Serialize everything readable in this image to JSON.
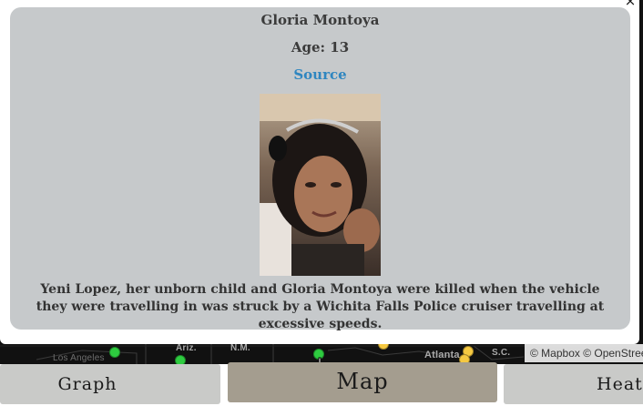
{
  "popup": {
    "name": "Gloria Montoya",
    "age": "Age: 13",
    "source_link": "Source",
    "description": "Yeni Lopez, her unborn child and Gloria Montoya were killed when the vehicle they were travelling in was struck by a Wichita Falls Police cruiser travelling at excessive speeds.",
    "close_symbol": "×",
    "photo_icon": "portrait-photo"
  },
  "map": {
    "labels": {
      "los_angeles": "Los Angeles",
      "ariz": "Ariz.",
      "nm": "N.M.",
      "atlanta": "Atlanta",
      "sc": "S.C."
    },
    "attribution": "© Mapbox © OpenStreetMap",
    "colors": {
      "background": "#111111",
      "marker_green": "#2ecc40",
      "marker_yellow": "#f6c941"
    }
  },
  "tabs": {
    "graph": "Graph",
    "map": "Map",
    "heatmap": "Heatmap",
    "active_color": "#a49d8f",
    "inactive_color": "#c9cac8"
  }
}
